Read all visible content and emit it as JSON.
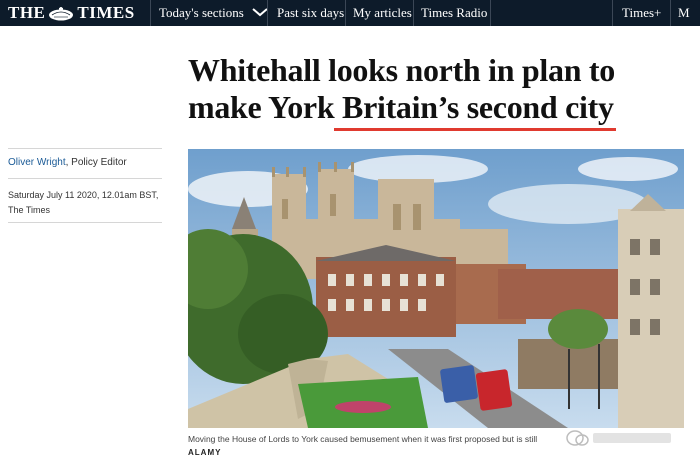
{
  "nav": {
    "logo_left": "THE",
    "logo_right": "TIMES",
    "sections_label": "Today's sections",
    "past_label": "Past six days",
    "articles_label": "My articles",
    "radio_label": "Times Radio",
    "plus_label": "Times+",
    "cut_label": "M"
  },
  "article": {
    "headline_line1": "Whitehall looks north in plan to",
    "headline_line2": "make York Britain’s second city",
    "author_name": "Oliver Wright",
    "author_role": ", Policy Editor",
    "date_line": "Saturday July 11 2020, 12.01am BST,",
    "publication": "The Times",
    "caption": "Moving the House of Lords to York caused bemusement when it was first proposed but is still",
    "credit": "ALAMY",
    "image_alt": "York Minster towers over the city walls and a busy street with red buses"
  },
  "colors": {
    "nav_bg": "#0d1b2a",
    "accent_red": "#e03a2f",
    "link_blue": "#1a5a96"
  },
  "icons": {
    "dropdown": "chevron-down-icon",
    "crest": "crest-icon",
    "watermark": "wechat-watermark-icon"
  }
}
